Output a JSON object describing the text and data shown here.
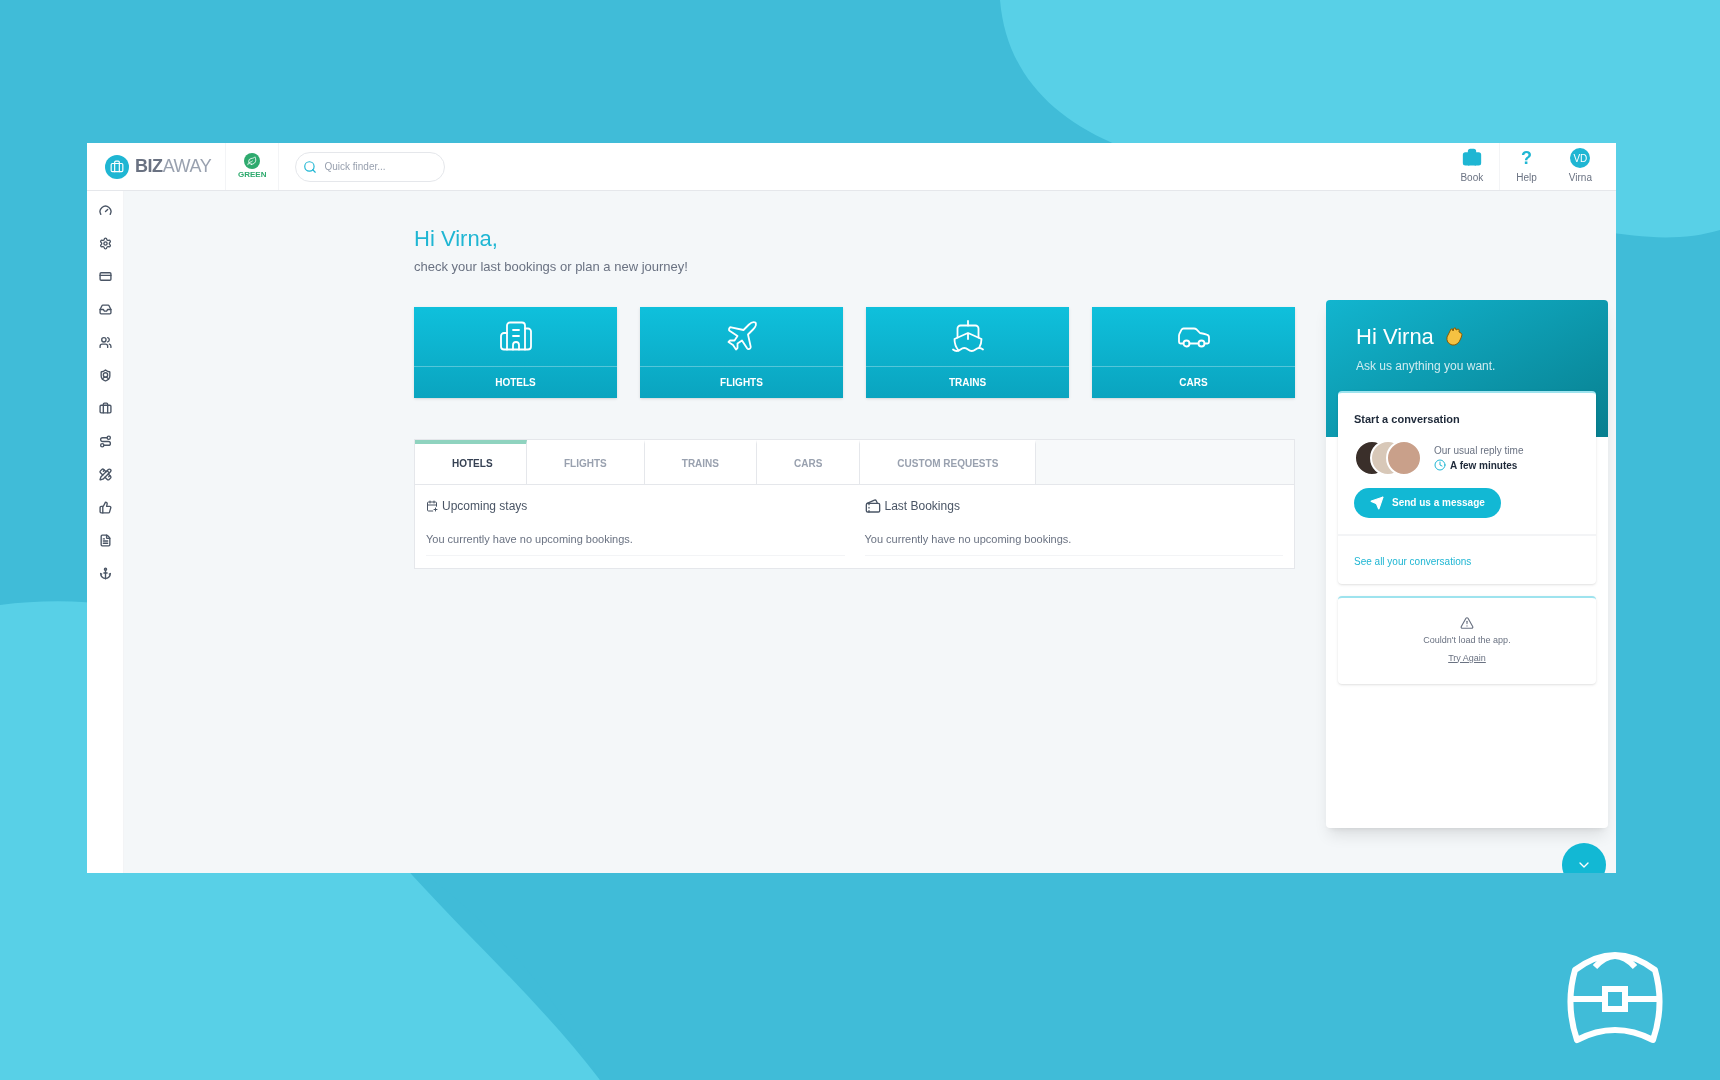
{
  "header": {
    "logo": {
      "bold": "BIZ",
      "light": "AWAY"
    },
    "green_badge": "GREEN",
    "search": {
      "placeholder": "Quick finder..."
    },
    "actions": [
      {
        "kind": "book",
        "label": "Book"
      },
      {
        "kind": "help",
        "label": "Help",
        "glyph": "?"
      },
      {
        "kind": "user",
        "label": "Virna",
        "initials": "VD"
      }
    ]
  },
  "sidebar": {
    "items": [
      {
        "kind": "dashboard"
      },
      {
        "kind": "settings"
      },
      {
        "kind": "card"
      },
      {
        "kind": "inbox"
      },
      {
        "kind": "users"
      },
      {
        "kind": "shield"
      },
      {
        "kind": "briefcase"
      },
      {
        "kind": "route"
      },
      {
        "kind": "tools"
      },
      {
        "kind": "thumb"
      },
      {
        "kind": "document"
      },
      {
        "kind": "anchor"
      }
    ]
  },
  "greeting": {
    "title": "Hi Virna,",
    "subtitle": "check your last bookings or plan a new journey!"
  },
  "services": [
    {
      "kind": "hotel",
      "label": "HOTELS"
    },
    {
      "kind": "flight",
      "label": "FLIGHTS"
    },
    {
      "kind": "train",
      "label": "TRAINS"
    },
    {
      "kind": "car",
      "label": "CARS"
    }
  ],
  "tabs": [
    {
      "label": "HOTELS",
      "selected": true
    },
    {
      "label": "FLIGHTS",
      "selected": false
    },
    {
      "label": "TRAINS",
      "selected": false
    },
    {
      "label": "CARS",
      "selected": false
    },
    {
      "label": "CUSTOM REQUESTS",
      "selected": false
    }
  ],
  "panels": [
    {
      "kind": "upcoming",
      "title": "Upcoming stays",
      "message": "You currently have no upcoming bookings."
    },
    {
      "kind": "last",
      "title": "Last Bookings",
      "message": "You currently have no upcoming bookings."
    }
  ],
  "chat": {
    "title": "Hi Virna",
    "subtitle": "Ask us anything you want.",
    "card_title": "Start a conversation",
    "reply_label": "Our usual reply time",
    "reply_time": "A few minutes",
    "send_button": "Send us a message",
    "link": "See all your conversations",
    "error": "Couldn't load the app.",
    "retry": "Try Again"
  }
}
